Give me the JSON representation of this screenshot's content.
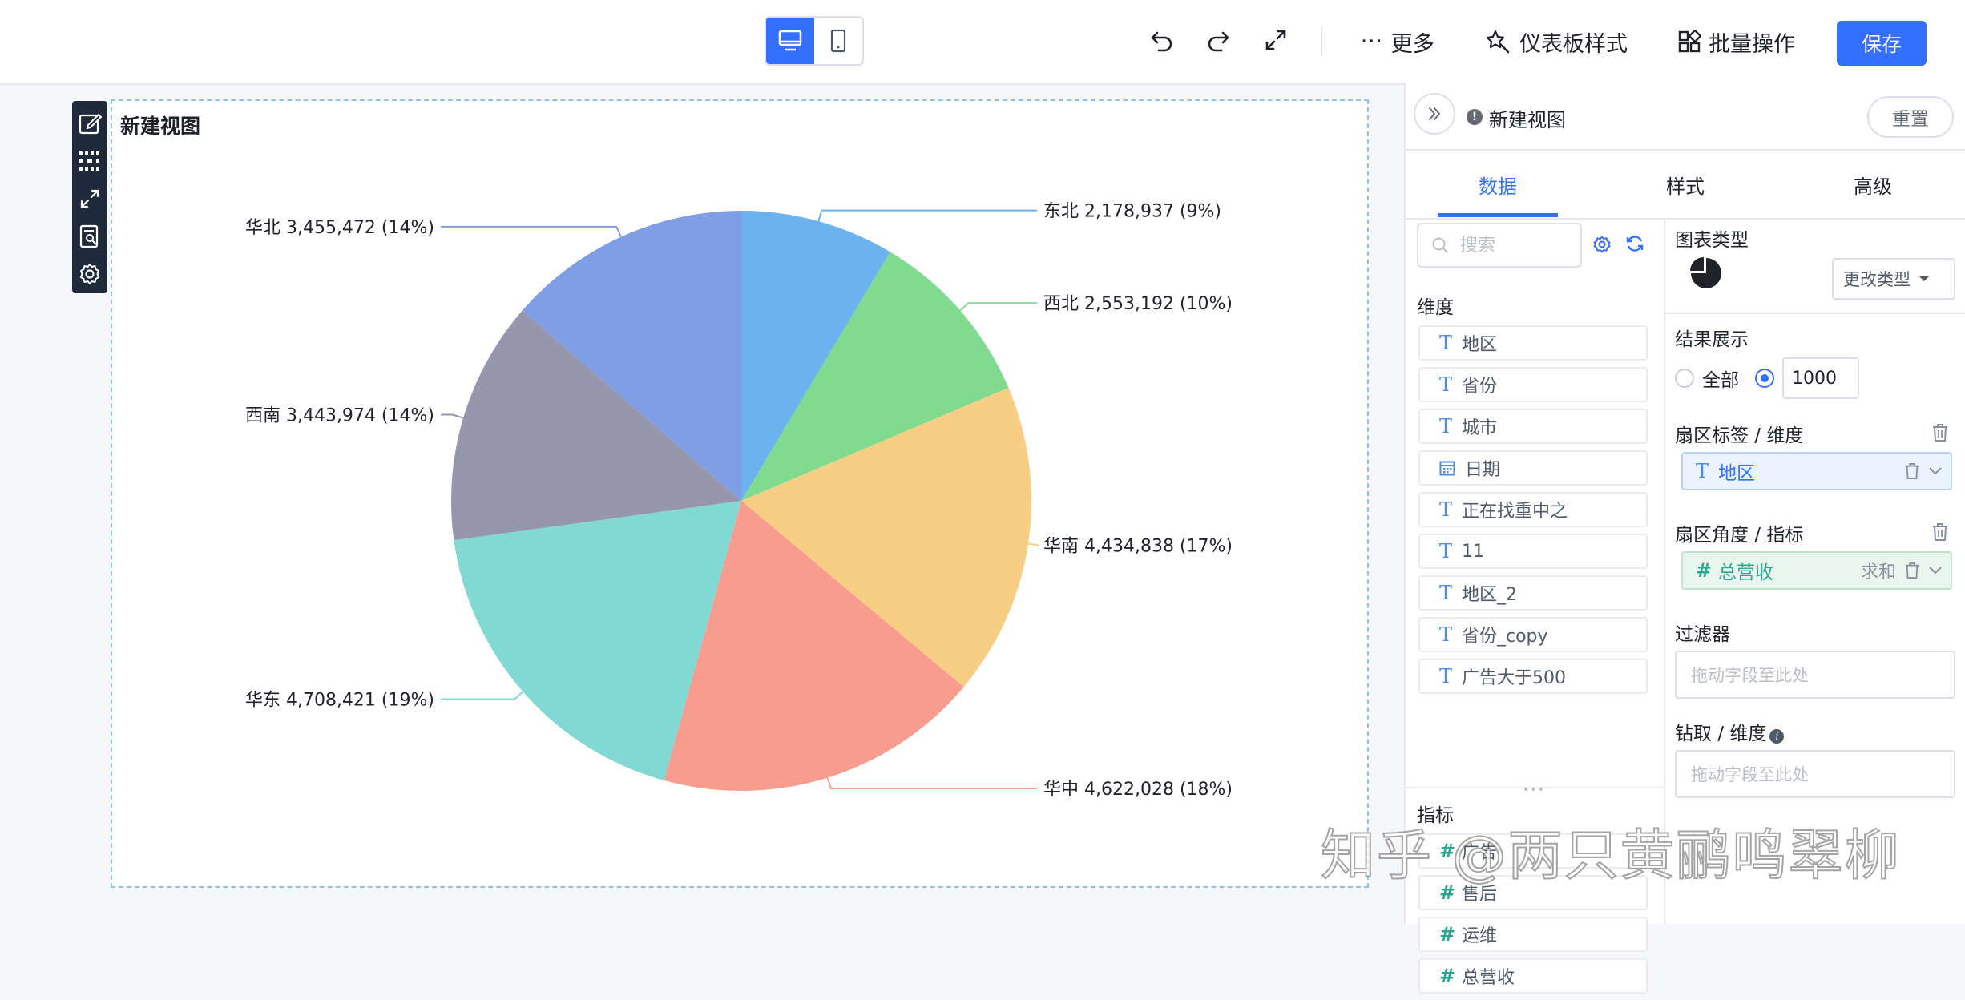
{
  "toolbar": {
    "more_label": "更多",
    "dashboard_style_label": "仪表板样式",
    "batch_label": "批量操作",
    "save_label": "保存"
  },
  "view": {
    "title": "新建视图"
  },
  "chart_data": {
    "type": "pie",
    "categories": [
      "东北",
      "西北",
      "华南",
      "华中",
      "华东",
      "西南",
      "华北"
    ],
    "values": [
      2178937,
      2553192,
      4434838,
      4622028,
      4708421,
      3443974,
      3455472
    ],
    "labels": [
      "东北 2,178,937 (9%)",
      "西北 2,553,192 (10%)",
      "华南 4,434,838 (17%)",
      "华中 4,622,028 (18%)",
      "华东 4,708,421 (19%)",
      "西南 3,443,974 (14%)",
      "华北 3,455,472 (14%)"
    ],
    "colors": [
      "#6bb3ee",
      "#80da8f",
      "#f7ce84",
      "#f79c8f",
      "#82d9d3",
      "#9697ad",
      "#7f9ee5"
    ],
    "start": "12 o'clock",
    "direction": "clockwise"
  },
  "panel": {
    "title": "新建视图",
    "reset_label": "重置",
    "tabs": [
      "数据",
      "样式",
      "高级"
    ],
    "search_placeholder": "搜索",
    "dimensions_label": "维度",
    "dimensions": [
      {
        "icon": "T",
        "name": "地区"
      },
      {
        "icon": "T",
        "name": "省份"
      },
      {
        "icon": "T",
        "name": "城市"
      },
      {
        "icon": "calendar",
        "name": "日期"
      },
      {
        "icon": "T",
        "name": "正在找重中之"
      },
      {
        "icon": "T",
        "name": "11"
      },
      {
        "icon": "T",
        "name": "地区_2"
      },
      {
        "icon": "T",
        "name": "省份_copy"
      },
      {
        "icon": "T",
        "name": "广告大于500"
      }
    ],
    "metrics_label": "指标",
    "metrics": [
      "广告",
      "售后",
      "运维",
      "总营收"
    ],
    "chart_type_label": "图表类型",
    "change_type_label": "更改类型",
    "result_label": "结果展示",
    "all_label": "全部",
    "limit_value": "1000",
    "sector_label_title": "扇区标签 / 维度",
    "sector_label_field": "地区",
    "sector_angle_title": "扇区角度 / 指标",
    "sector_angle_field": "总营收",
    "sector_angle_agg": "求和",
    "filter_label": "过滤器",
    "drop_placeholder": "拖动字段至此处",
    "drill_label": "钻取 / 维度",
    "drill_placeholder": "拖动字段至此处"
  },
  "watermark": "知乎 @两只黄鹂鸣翠柳"
}
